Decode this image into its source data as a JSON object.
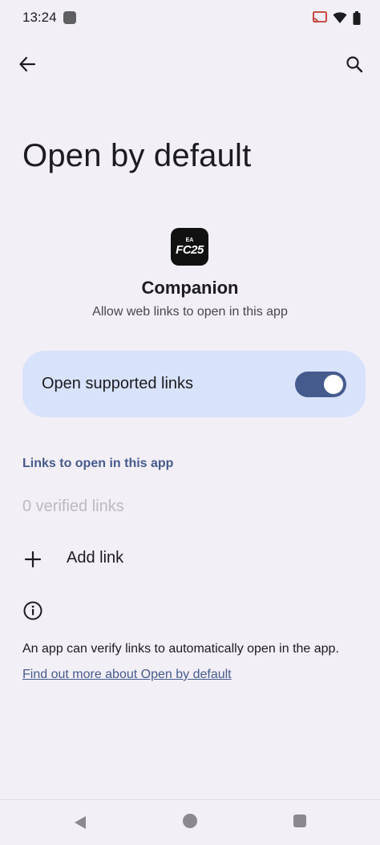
{
  "status_bar": {
    "time": "13:24"
  },
  "header": {
    "title": "Open by default"
  },
  "app": {
    "name": "Companion",
    "subtitle": "Allow web links to open in this app",
    "icon_text_top": "EA",
    "icon_text_main": "FC25"
  },
  "toggle": {
    "label": "Open supported links",
    "enabled": true,
    "accent_color": "#455b8e",
    "card_color": "#d8e2fb"
  },
  "links_section": {
    "header": "Links to open in this app",
    "verified": "0 verified links",
    "add_label": "Add link"
  },
  "info": {
    "text": "An app can verify links to automatically open in the app.",
    "link": "Find out more about Open by default"
  },
  "icons": {
    "back": "arrow-back-icon",
    "search": "search-icon",
    "add": "plus-icon",
    "info": "info-icon"
  }
}
